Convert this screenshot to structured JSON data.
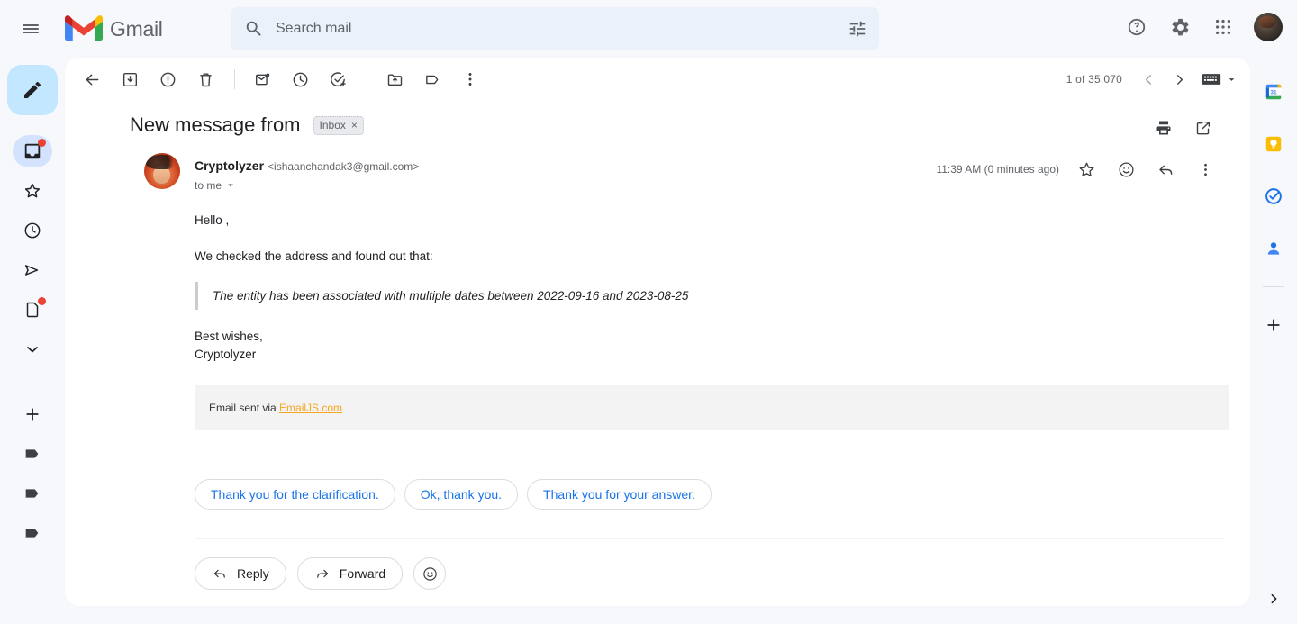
{
  "app": {
    "brand": "Gmail",
    "menu_icon": "hamburger-icon"
  },
  "search": {
    "placeholder": "Search mail",
    "value": "",
    "icon": "search-icon",
    "options_icon": "search-options-tune-icon"
  },
  "header_actions": [
    {
      "name": "support-help-icon",
      "label": "Support"
    },
    {
      "name": "settings-gear-icon",
      "label": "Settings"
    },
    {
      "name": "google-apps-grid-icon",
      "label": "Google apps"
    },
    {
      "name": "account-avatar",
      "label": "Google Account"
    }
  ],
  "sidebar": {
    "compose_label": "Compose",
    "items": [
      {
        "name": "inbox",
        "label": "Inbox",
        "active": true,
        "badge": true
      },
      {
        "name": "starred",
        "label": "Starred",
        "active": false,
        "badge": false
      },
      {
        "name": "snoozed",
        "label": "Snoozed",
        "active": false,
        "badge": false
      },
      {
        "name": "sent",
        "label": "Sent",
        "active": false,
        "badge": false
      },
      {
        "name": "drafts",
        "label": "Drafts",
        "active": false,
        "badge": true
      },
      {
        "name": "more",
        "label": "More",
        "active": false,
        "badge": false
      }
    ],
    "create_label": "Create new label",
    "labels": [
      {
        "label": "Label 1"
      },
      {
        "label": "Label 2"
      },
      {
        "label": "Label 3"
      }
    ]
  },
  "toolbar": {
    "back_label": "Back to Inbox",
    "archive_label": "Archive",
    "spam_label": "Report spam",
    "delete_label": "Delete",
    "unread_label": "Mark as unread",
    "snooze_label": "Snooze",
    "tasks_label": "Add to Tasks",
    "move_label": "Move to",
    "labels_label": "Labels",
    "more_label": "More",
    "page_count": "1 of 35,070",
    "prev_label": "Newer",
    "next_label": "Older",
    "input_tools_label": "Select input tool"
  },
  "message": {
    "subject": "New message from",
    "label_chip": "Inbox",
    "label_chip_remove": "×",
    "print_label": "Print all",
    "popout_label": "Open in new window",
    "sender_name": "Cryptolyzer",
    "sender_email": "<ishaanchandak3@gmail.com>",
    "to_line": "to me",
    "timestamp": "11:39 AM (0 minutes ago)",
    "star_label": "Star",
    "react_label": "Add emoji reaction",
    "reply_icon_label": "Reply",
    "more_label": "More",
    "body": {
      "greeting": "Hello ,",
      "intro": "We checked the address and found out that:",
      "quote": "The entity has been associated with multiple dates between 2022-09-16 and 2023-08-25",
      "signoff_1": "Best wishes,",
      "signoff_2": "Cryptolyzer"
    },
    "footer": {
      "text_before": "Email sent via ",
      "link_text": "EmailJS.com"
    }
  },
  "smart_replies": [
    {
      "label": "Thank you for the clarification."
    },
    {
      "label": "Ok, thank you."
    },
    {
      "label": "Thank you for your answer."
    }
  ],
  "actions": {
    "reply_label": "Reply",
    "forward_label": "Forward",
    "react_label": "React"
  },
  "right_rail": [
    {
      "name": "google-calendar-icon",
      "label": "Calendar",
      "day": "31"
    },
    {
      "name": "google-keep-icon",
      "label": "Keep"
    },
    {
      "name": "google-tasks-icon",
      "label": "Tasks"
    },
    {
      "name": "google-contacts-icon",
      "label": "Contacts"
    },
    {
      "name": "get-addons-plus-icon",
      "label": "Get Add-ons"
    }
  ],
  "right_rail_expand": "Show side panel",
  "colors": {
    "page_bg": "#f6f8fc",
    "panel_bg": "#ffffff",
    "search_bg": "#eaf1fb",
    "compose_bg": "#c2e7ff",
    "active_nav": "#d3e3fd",
    "accent_blue": "#1a73e8",
    "badge_red": "#ea4335",
    "link_orange": "#f5a623",
    "icon_grey": "#5f6368",
    "text_primary": "#202124"
  }
}
